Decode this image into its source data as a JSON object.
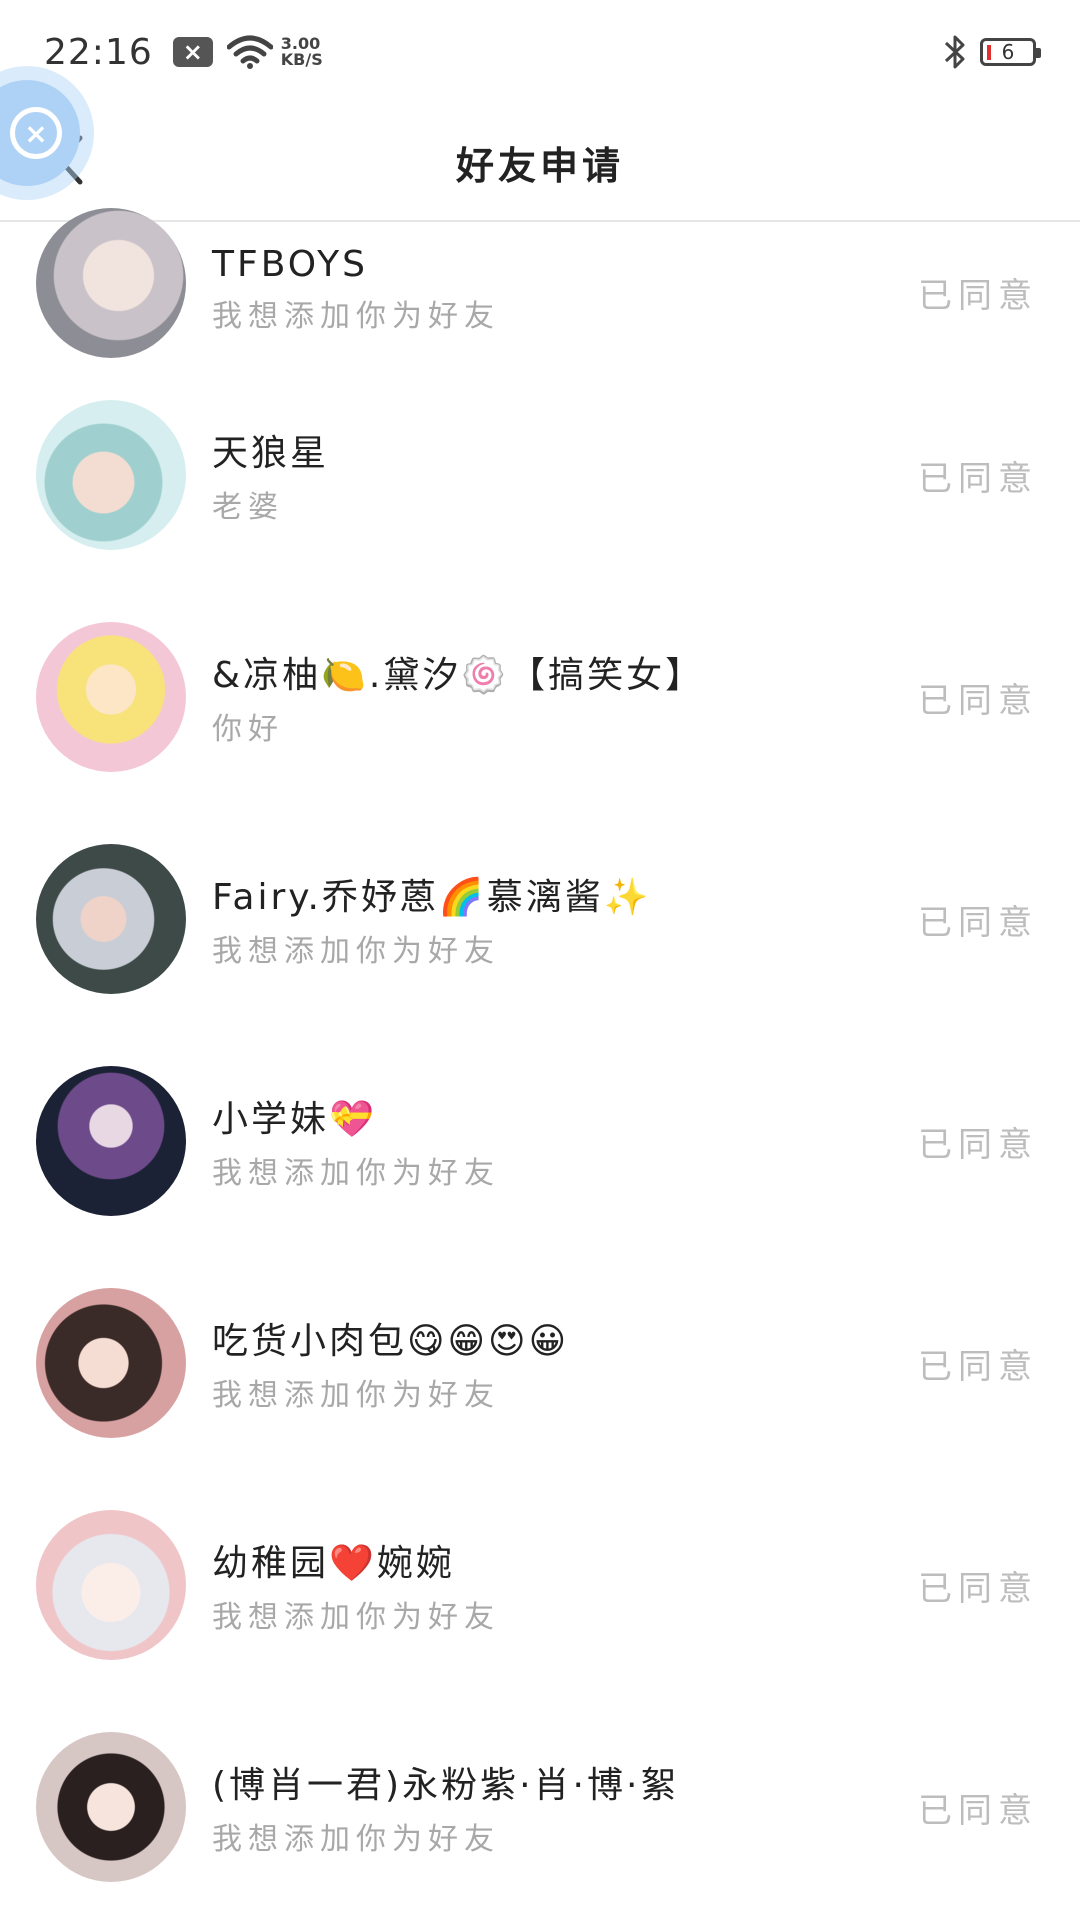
{
  "statusbar": {
    "time": "22:16",
    "speed_value": "3.00",
    "speed_unit": "KB/S",
    "battery_level": "6",
    "icons": [
      "notification-x-icon",
      "wifi-icon",
      "bluetooth-icon",
      "battery-icon"
    ]
  },
  "header": {
    "title": "好友申请",
    "back_icon": "chevron-left-icon",
    "floating_icon": "close-circle-icon"
  },
  "requests": [
    {
      "name": "TFBOYS",
      "message": "我想添加你为好友",
      "status": "已同意"
    },
    {
      "name": "天狼星",
      "message": "老婆",
      "status": "已同意"
    },
    {
      "name": "&凉柚🍋.黛汐🍥【搞笑女】",
      "message": "你好",
      "status": "已同意"
    },
    {
      "name": "Fairy.乔妤蒽🌈慕漓酱✨",
      "message": "我想添加你为好友",
      "status": "已同意"
    },
    {
      "name": "小学妹💝",
      "message": "我想添加你为好友",
      "status": "已同意"
    },
    {
      "name": "吃货小肉包😋😁😍😀",
      "message": "我想添加你为好友",
      "status": "已同意"
    },
    {
      "name": "幼稚园❤️婉婉",
      "message": "我想添加你为好友",
      "status": "已同意"
    },
    {
      "name": "(博肖一君)永粉紫·肖·博·絮",
      "message": "我想添加你为好友",
      "status": "已同意"
    }
  ],
  "colors": {
    "accent_float": "#aed2f6",
    "status_text": "#bdbdbd",
    "message_text": "#a8a8a8",
    "divider": "#e6e6e6"
  }
}
